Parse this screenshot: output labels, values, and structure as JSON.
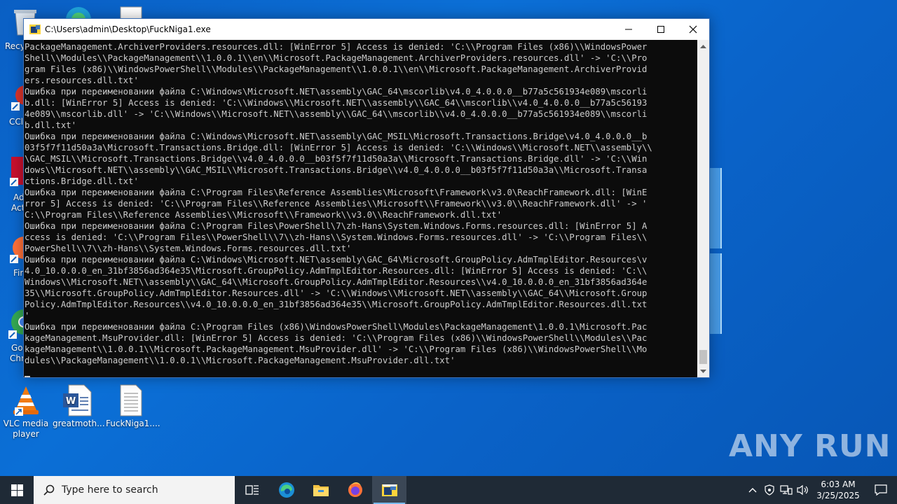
{
  "desktop": {
    "icons": [
      {
        "label": "VLC media player",
        "icon": "vlc-icon"
      },
      {
        "label": "greatmoth...",
        "icon": "word-document-icon"
      },
      {
        "label": "FuckNiga1....",
        "icon": "text-file-icon"
      }
    ],
    "edge_labels": [
      "Recy",
      "CCl",
      "Ad",
      "Act",
      "Fir",
      "Go",
      "Chr"
    ],
    "watermark": "ANY RUN"
  },
  "window": {
    "title": "C:\\Users\\admin\\Desktop\\FuckNiga1.exe",
    "console_lines": [
      "PackageManagement.ArchiverProviders.resources.dll: [WinError 5] Access is denied: 'C:\\\\Program Files (x86)\\\\WindowsPower",
      "Shell\\\\Modules\\\\PackageManagement\\\\1.0.0.1\\\\en\\\\Microsoft.PackageManagement.ArchiverProviders.resources.dll' -> 'C:\\\\Pro",
      "gram Files (x86)\\\\WindowsPowerShell\\\\Modules\\\\PackageManagement\\\\1.0.0.1\\\\en\\\\Microsoft.PackageManagement.ArchiverProvid",
      "ers.resources.dll.txt'",
      "Ошибка при переименовании файла C:\\Windows\\Microsoft.NET\\assembly\\GAC_64\\mscorlib\\v4.0_4.0.0.0__b77a5c561934e089\\mscorli",
      "b.dll: [WinError 5] Access is denied: 'C:\\\\Windows\\\\Microsoft.NET\\\\assembly\\\\GAC_64\\\\mscorlib\\\\v4.0_4.0.0.0__b77a5c56193",
      "4e089\\\\mscorlib.dll' -> 'C:\\\\Windows\\\\Microsoft.NET\\\\assembly\\\\GAC_64\\\\mscorlib\\\\v4.0_4.0.0.0__b77a5c561934e089\\\\mscorli",
      "b.dll.txt'",
      "Ошибка при переименовании файла C:\\Windows\\Microsoft.NET\\assembly\\GAC_MSIL\\Microsoft.Transactions.Bridge\\v4.0_4.0.0.0__b",
      "03f5f7f11d50a3a\\Microsoft.Transactions.Bridge.dll: [WinError 5] Access is denied: 'C:\\\\Windows\\\\Microsoft.NET\\\\assembly\\\\",
      "\\GAC_MSIL\\\\Microsoft.Transactions.Bridge\\\\v4.0_4.0.0.0__b03f5f7f11d50a3a\\\\Microsoft.Transactions.Bridge.dll' -> 'C:\\\\Win",
      "dows\\\\Microsoft.NET\\\\assembly\\\\GAC_MSIL\\\\Microsoft.Transactions.Bridge\\\\v4.0_4.0.0.0__b03f5f7f11d50a3a\\\\Microsoft.Transa",
      "ctions.Bridge.dll.txt'",
      "Ошибка при переименовании файла C:\\Program Files\\Reference Assemblies\\Microsoft\\Framework\\v3.0\\ReachFramework.dll: [WinE",
      "rror 5] Access is denied: 'C:\\\\Program Files\\\\Reference Assemblies\\\\Microsoft\\\\Framework\\\\v3.0\\\\ReachFramework.dll' -> '",
      "C:\\\\Program Files\\\\Reference Assemblies\\\\Microsoft\\\\Framework\\\\v3.0\\\\ReachFramework.dll.txt'",
      "Ошибка при переименовании файла C:\\Program Files\\PowerShell\\7\\zh-Hans\\System.Windows.Forms.resources.dll: [WinError 5] A",
      "ccess is denied: 'C:\\\\Program Files\\\\PowerShell\\\\7\\\\zh-Hans\\\\System.Windows.Forms.resources.dll' -> 'C:\\\\Program Files\\\\",
      "PowerShell\\\\7\\\\zh-Hans\\\\System.Windows.Forms.resources.dll.txt'",
      "Ошибка при переименовании файла C:\\Windows\\Microsoft.NET\\assembly\\GAC_64\\Microsoft.GroupPolicy.AdmTmplEditor.Resources\\v",
      "4.0_10.0.0.0_en_31bf3856ad364e35\\Microsoft.GroupPolicy.AdmTmplEditor.Resources.dll: [WinError 5] Access is denied: 'C:\\\\",
      "Windows\\\\Microsoft.NET\\\\assembly\\\\GAC_64\\\\Microsoft.GroupPolicy.AdmTmplEditor.Resources\\\\v4.0_10.0.0.0_en_31bf3856ad364e",
      "35\\\\Microsoft.GroupPolicy.AdmTmplEditor.Resources.dll' -> 'C:\\\\Windows\\\\Microsoft.NET\\\\assembly\\\\GAC_64\\\\Microsoft.Group",
      "Policy.AdmTmplEditor.Resources\\\\v4.0_10.0.0.0_en_31bf3856ad364e35\\\\Microsoft.GroupPolicy.AdmTmplEditor.Resources.dll.txt",
      "'",
      "Ошибка при переименовании файла C:\\Program Files (x86)\\WindowsPowerShell\\Modules\\PackageManagement\\1.0.0.1\\Microsoft.Pac",
      "kageManagement.MsuProvider.dll: [WinError 5] Access is denied: 'C:\\\\Program Files (x86)\\\\WindowsPowerShell\\\\Modules\\\\Pac",
      "kageManagement\\\\1.0.0.1\\\\Microsoft.PackageManagement.MsuProvider.dll' -> 'C:\\\\Program Files (x86)\\\\WindowsPowerShell\\\\Mo",
      "dules\\\\PackageManagement\\\\1.0.0.1\\\\Microsoft.PackageManagement.MsuProvider.dll.txt'",
      ""
    ]
  },
  "taskbar": {
    "search_placeholder": "Type here to search",
    "time": "6:03 AM",
    "date": "3/25/2025"
  },
  "colors": {
    "console_bg": "#0c0c0c",
    "console_fg": "#cccccc",
    "taskbar_bg": "#1f2a36",
    "desktop_bg": "#0a63c9"
  }
}
